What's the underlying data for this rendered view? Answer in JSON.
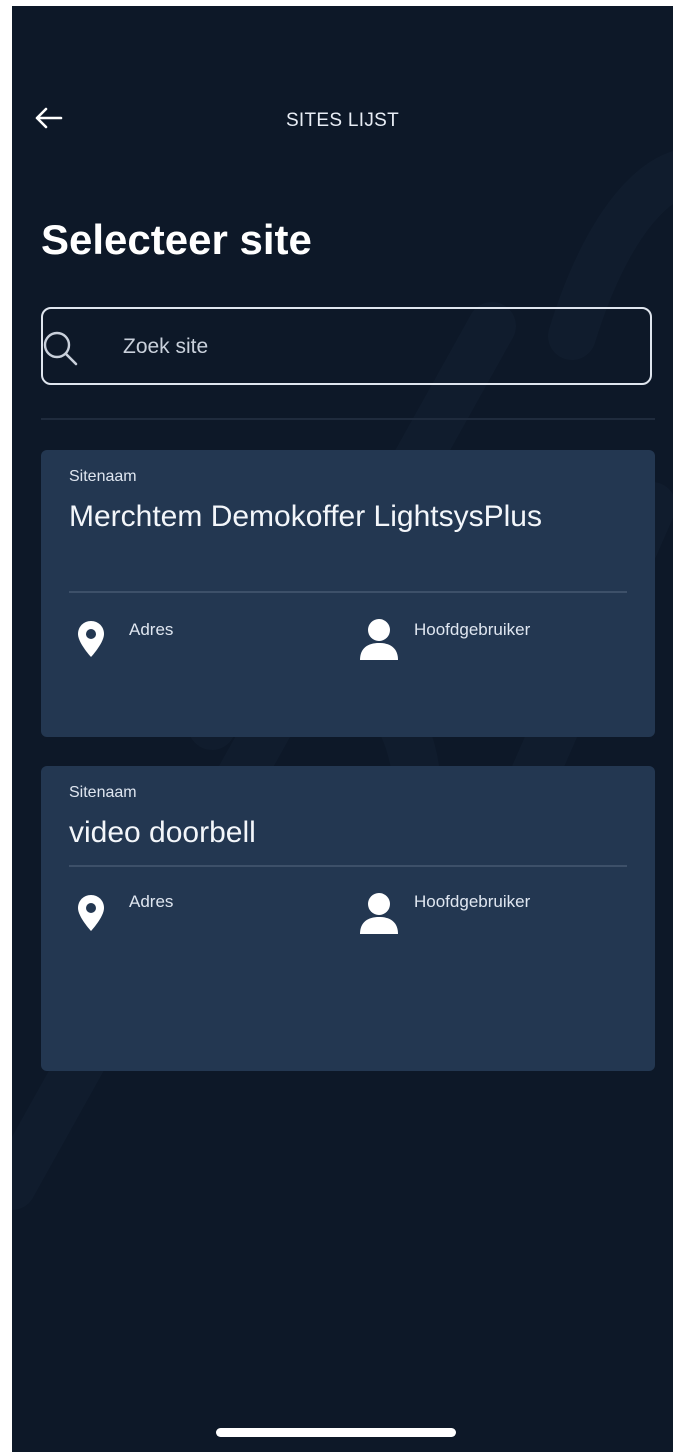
{
  "header": {
    "title": "SITES LIJST",
    "back_icon": "arrow-left-icon"
  },
  "page": {
    "title": "Selecteer site"
  },
  "search": {
    "placeholder": "Zoek site",
    "value": "",
    "icon": "search-icon"
  },
  "sites": [
    {
      "label": "Sitenaam",
      "name": "Merchtem Demokoffer LightsysPlus",
      "address_label": "Adres",
      "main_user_label": "Hoofdgebruiker"
    },
    {
      "label": "Sitenaam",
      "name": "video doorbell",
      "address_label": "Adres",
      "main_user_label": "Hoofdgebruiker"
    }
  ],
  "colors": {
    "background": "#0d1828",
    "card": "#233751",
    "text": "#f3f6fa"
  }
}
